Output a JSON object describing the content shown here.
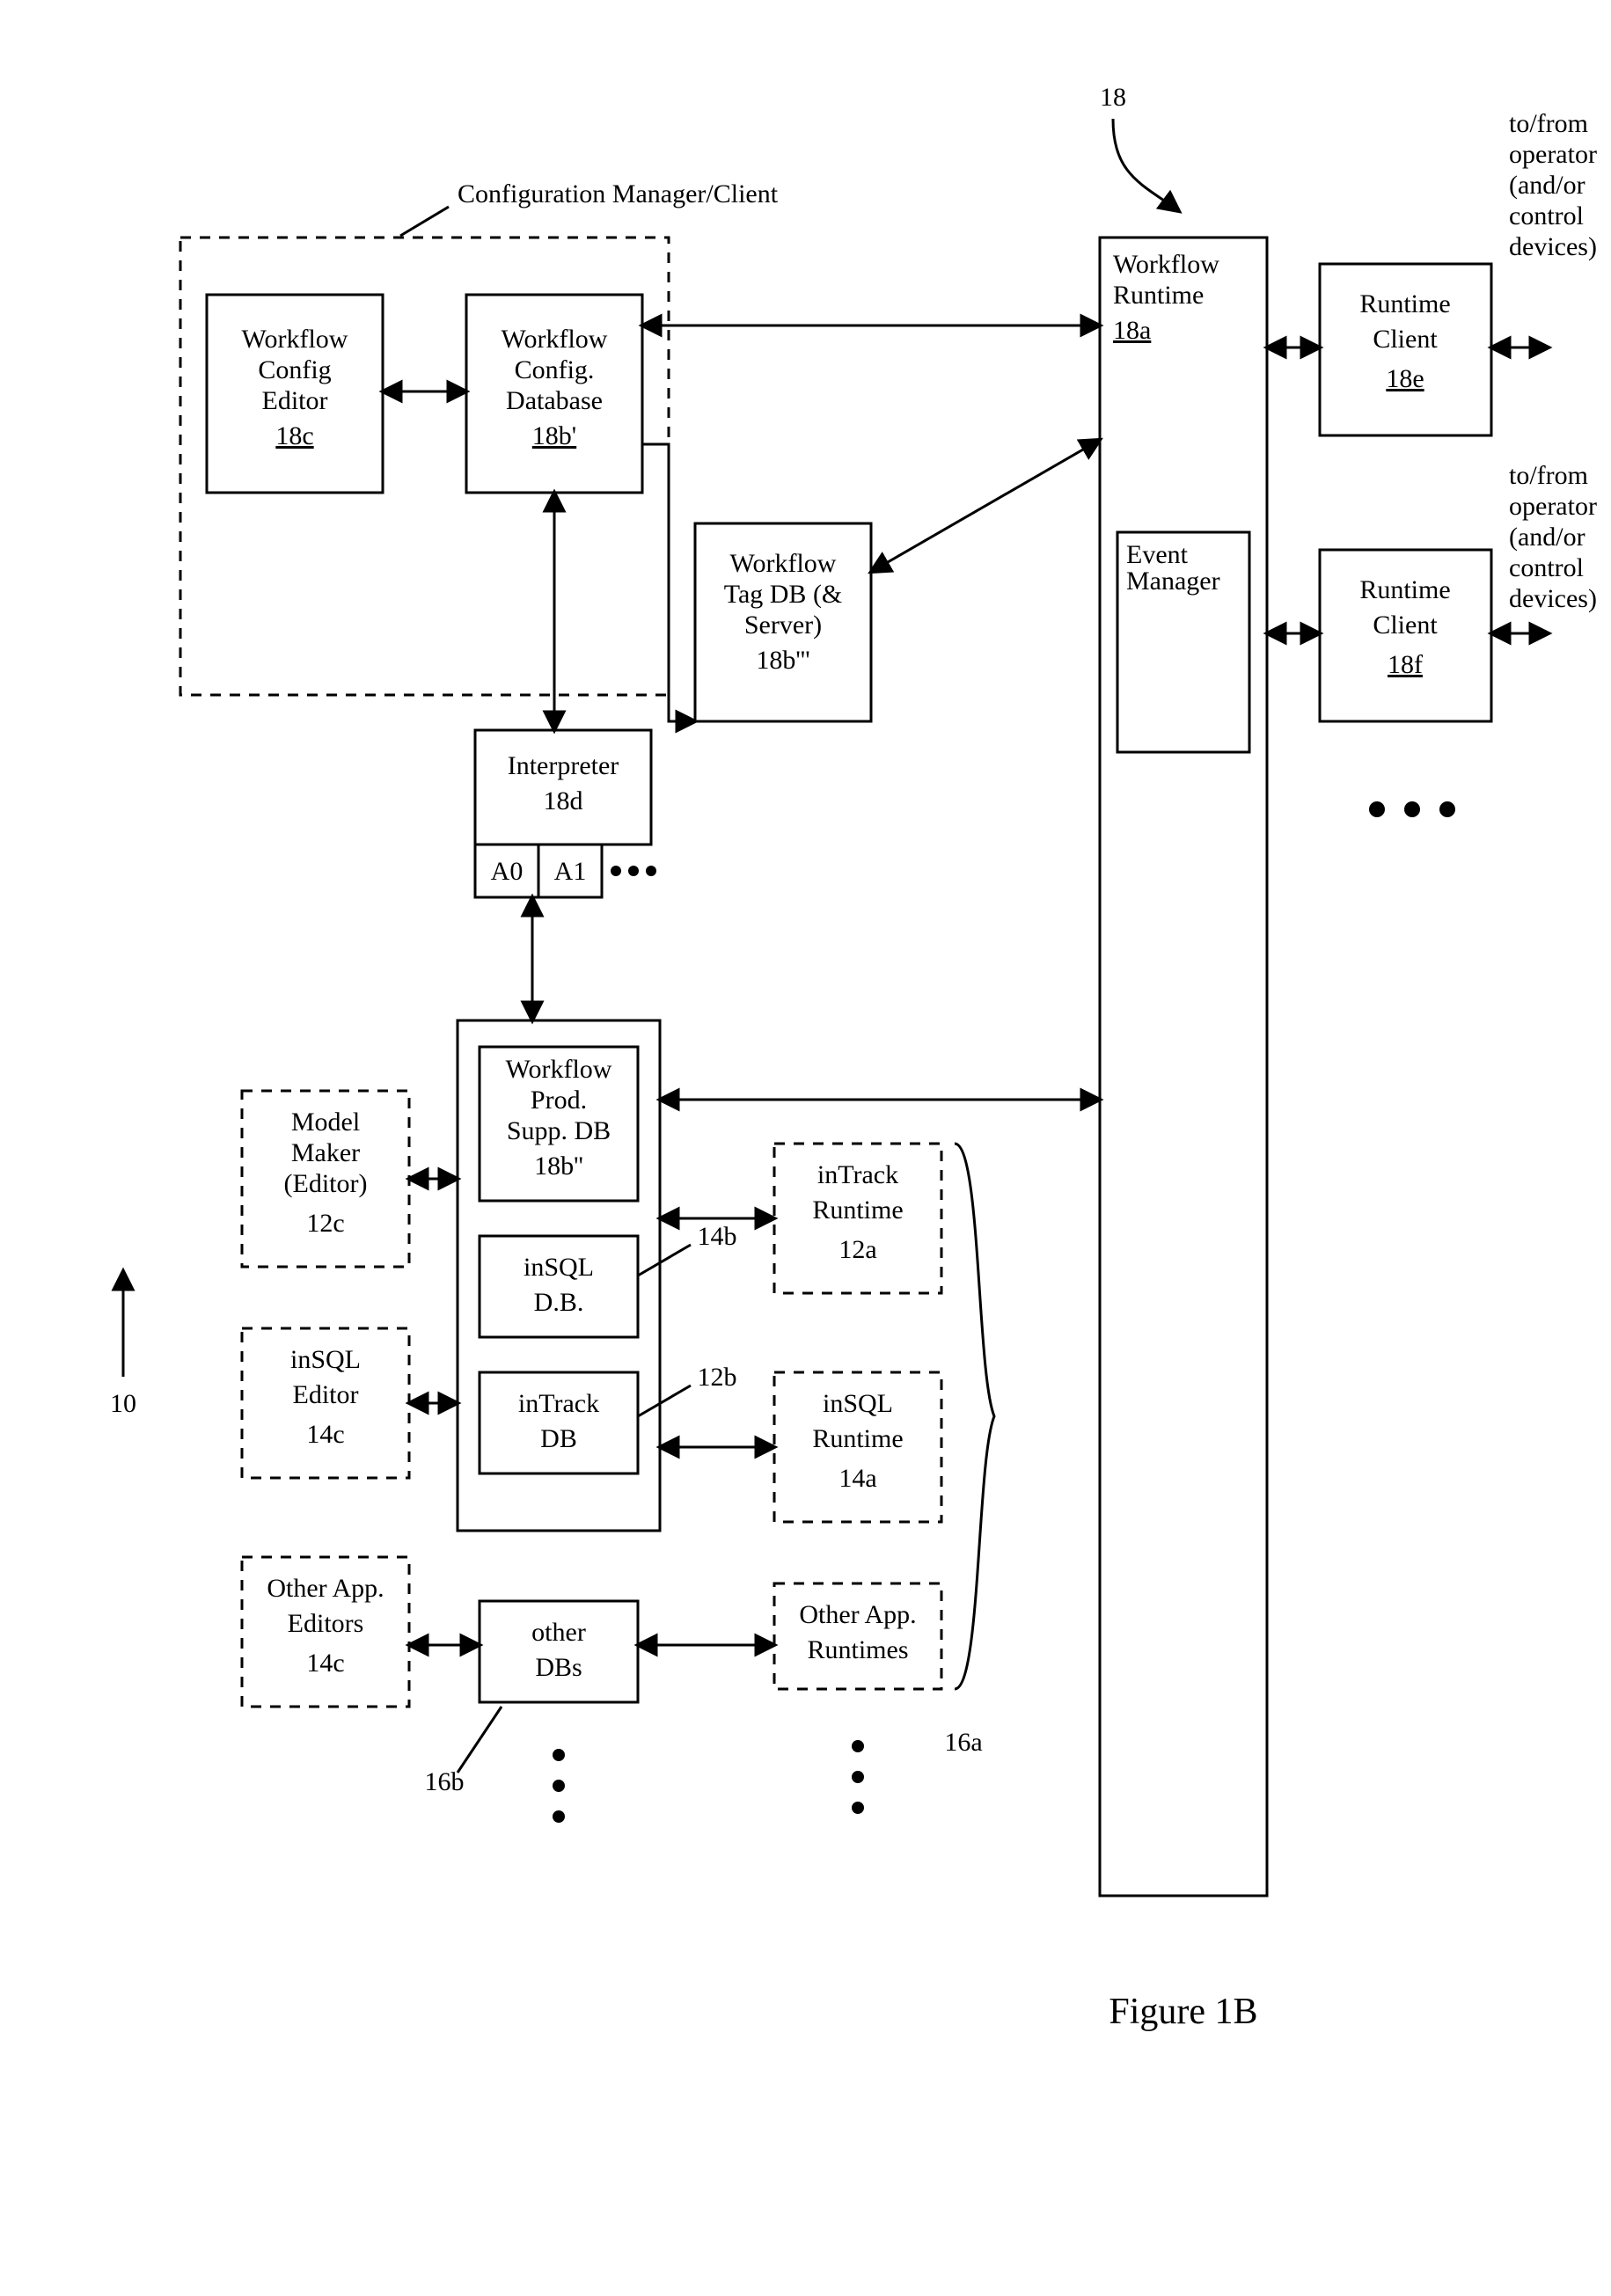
{
  "figure_label": "Figure 1B",
  "system_ref": "10",
  "workflow_ref": "18",
  "config_manager_label": "Configuration Manager/Client",
  "runtimes_brace_ref": "16a",
  "other_dbs_ref": "16b",
  "insql_db_ref": "14b",
  "intrack_db_ref": "12b",
  "boxes": {
    "config_editor": {
      "l1": "Workflow",
      "l2": "Config",
      "l3": "Editor",
      "ref": "18c"
    },
    "config_db": {
      "l1": "Workflow",
      "l2": "Config.",
      "l3": "Database",
      "ref": "18b'"
    },
    "tag_db": {
      "l1": "Workflow",
      "l2": "Tag DB (&",
      "l3": "Server)",
      "ref": "18b'''"
    },
    "interpreter": {
      "l1": "Interpreter",
      "ref": "18d",
      "a0": "A0",
      "a1": "A1"
    },
    "prod_supp": {
      "l1": "Workflow",
      "l2": "Prod.",
      "l3": "Supp. DB",
      "ref": "18b''"
    },
    "insql_db": {
      "l1": "inSQL",
      "l2": "D.B."
    },
    "intrack_db": {
      "l1": "inTrack",
      "l2": "DB"
    },
    "other_dbs": {
      "l1": "other",
      "l2": "DBs"
    },
    "model_maker": {
      "l1": "Model",
      "l2": "Maker",
      "l3": "(Editor)",
      "ref": "12c"
    },
    "insql_editor": {
      "l1": "inSQL",
      "l2": "Editor",
      "ref": "14c"
    },
    "other_editors": {
      "l1": "Other App.",
      "l2": "Editors",
      "ref": "14c"
    },
    "intrack_rt": {
      "l1": "inTrack",
      "l2": "Runtime",
      "ref": "12a"
    },
    "insql_rt": {
      "l1": "inSQL",
      "l2": "Runtime",
      "ref": "14a"
    },
    "other_rt": {
      "l1": "Other App.",
      "l2": "Runtimes"
    },
    "wf_runtime": {
      "l1": "Workflow",
      "l2": "Runtime",
      "ref": "18a"
    },
    "event_mgr": {
      "l1": "Event",
      "l2": "Manager"
    },
    "rt_client_e": {
      "l1": "Runtime",
      "l2": "Client",
      "ref": "18e"
    },
    "rt_client_f": {
      "l1": "Runtime",
      "l2": "Client",
      "ref": "18f"
    },
    "operator_note": {
      "l1": "to/from",
      "l2": "operator",
      "l3": "(and/or",
      "l4": "control",
      "l5": "devices)"
    }
  }
}
